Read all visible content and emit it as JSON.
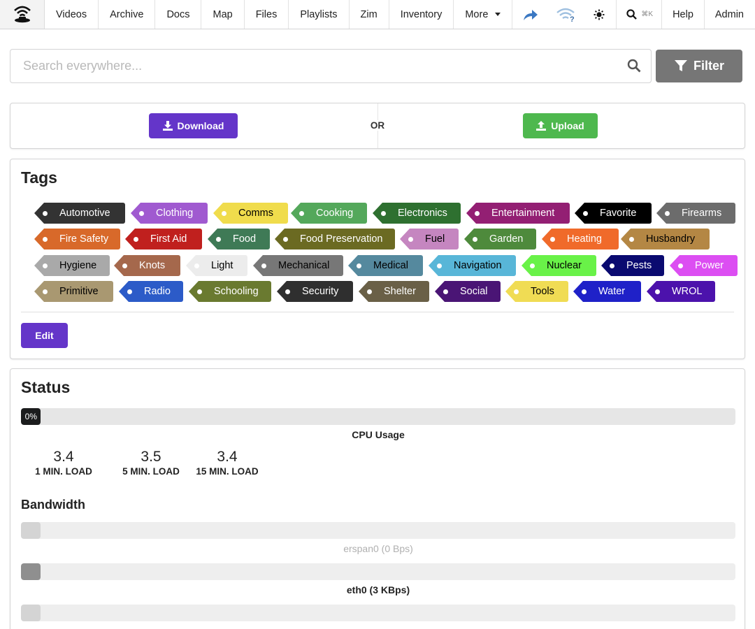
{
  "nav": {
    "items": [
      "Videos",
      "Archive",
      "Docs",
      "Map",
      "Files",
      "Playlists",
      "Zim",
      "Inventory"
    ],
    "more_label": "More",
    "search_shortcut": "⌘K",
    "help_label": "Help",
    "admin_label": "Admin"
  },
  "search": {
    "placeholder": "Search everywhere...",
    "value": "",
    "filter_label": "Filter"
  },
  "transfer": {
    "download_label": "Download",
    "or_label": "OR",
    "upload_label": "Upload"
  },
  "tags": {
    "title": "Tags",
    "edit_label": "Edit",
    "items": [
      {
        "name": "Automotive",
        "bg": "#333333",
        "fg": "#ffffff",
        "dot": "#ffffff"
      },
      {
        "name": "Clothing",
        "bg": "#a05ad0",
        "fg": "#ffffff",
        "dot": "#ffffff"
      },
      {
        "name": "Comms",
        "bg": "#f0dc4c",
        "fg": "#000000",
        "dot": "#ffffff"
      },
      {
        "name": "Cooking",
        "bg": "#54a85b",
        "fg": "#ffffff",
        "dot": "#ffffff"
      },
      {
        "name": "Electronics",
        "bg": "#2e7030",
        "fg": "#ffffff",
        "dot": "#ffffff"
      },
      {
        "name": "Entertainment",
        "bg": "#931f73",
        "fg": "#ffffff",
        "dot": "#ffffff"
      },
      {
        "name": "Favorite",
        "bg": "#000000",
        "fg": "#ffffff",
        "dot": "#ffffff"
      },
      {
        "name": "Firearms",
        "bg": "#6c6c6c",
        "fg": "#ffffff",
        "dot": "#ffffff"
      },
      {
        "name": "Fire Safety",
        "bg": "#d8692a",
        "fg": "#ffffff",
        "dot": "#ffffff"
      },
      {
        "name": "First Aid",
        "bg": "#c0201e",
        "fg": "#ffffff",
        "dot": "#ffffff"
      },
      {
        "name": "Food",
        "bg": "#3f7a56",
        "fg": "#ffffff",
        "dot": "#ffffff"
      },
      {
        "name": "Food Preservation",
        "bg": "#6b6a22",
        "fg": "#ffffff",
        "dot": "#ffffff"
      },
      {
        "name": "Fuel",
        "bg": "#c586c0",
        "fg": "#000000",
        "dot": "#ffffff"
      },
      {
        "name": "Garden",
        "bg": "#4e8a3c",
        "fg": "#ffffff",
        "dot": "#ffffff"
      },
      {
        "name": "Heating",
        "bg": "#f06a2a",
        "fg": "#ffffff",
        "dot": "#ffffff"
      },
      {
        "name": "Husbandry",
        "bg": "#b48744",
        "fg": "#000000",
        "dot": "#ffffff"
      },
      {
        "name": "Hygiene",
        "bg": "#a9a9a9",
        "fg": "#000000",
        "dot": "#ffffff"
      },
      {
        "name": "Knots",
        "bg": "#a5684c",
        "fg": "#ffffff",
        "dot": "#ffffff"
      },
      {
        "name": "Light",
        "bg": "#ececec",
        "fg": "#000000",
        "dot": "#ffffff"
      },
      {
        "name": "Mechanical",
        "bg": "#777777",
        "fg": "#000000",
        "dot": "#ffffff"
      },
      {
        "name": "Medical",
        "bg": "#55899e",
        "fg": "#000000",
        "dot": "#ffffff"
      },
      {
        "name": "Navigation",
        "bg": "#58b6d8",
        "fg": "#000000",
        "dot": "#ffffff"
      },
      {
        "name": "Nuclear",
        "bg": "#69f248",
        "fg": "#000000",
        "dot": "#ffffff"
      },
      {
        "name": "Pests",
        "bg": "#0a0a70",
        "fg": "#ffffff",
        "dot": "#ffffff"
      },
      {
        "name": "Power",
        "bg": "#dc4ef2",
        "fg": "#ffffff",
        "dot": "#ffffff"
      },
      {
        "name": "Primitive",
        "bg": "#a99871",
        "fg": "#000000",
        "dot": "#ffffff"
      },
      {
        "name": "Radio",
        "bg": "#2c5bc8",
        "fg": "#ffffff",
        "dot": "#ffffff"
      },
      {
        "name": "Schooling",
        "bg": "#6a7a30",
        "fg": "#ffffff",
        "dot": "#ffffff"
      },
      {
        "name": "Security",
        "bg": "#2f2f2f",
        "fg": "#ffffff",
        "dot": "#ffffff"
      },
      {
        "name": "Shelter",
        "bg": "#6a6047",
        "fg": "#ffffff",
        "dot": "#ffffff"
      },
      {
        "name": "Social",
        "bg": "#4a1575",
        "fg": "#ffffff",
        "dot": "#ffffff"
      },
      {
        "name": "Tools",
        "bg": "#f0dc54",
        "fg": "#000000",
        "dot": "#ffffff"
      },
      {
        "name": "Water",
        "bg": "#1f21c8",
        "fg": "#ffffff",
        "dot": "#ffffff"
      },
      {
        "name": "WROL",
        "bg": "#4c12ac",
        "fg": "#ffffff",
        "dot": "#ffffff"
      }
    ]
  },
  "status": {
    "title": "Status",
    "cpu": {
      "percent_label": "0%",
      "percent": 0,
      "label": "CPU Usage"
    },
    "loads": [
      {
        "value": "3.4",
        "label": "1 MIN. LOAD"
      },
      {
        "value": "3.5",
        "label": "5 MIN. LOAD"
      },
      {
        "value": "3.4",
        "label": "15 MIN. LOAD"
      }
    ],
    "bandwidth_title": "Bandwidth",
    "interfaces": [
      {
        "label": "erspan0 (0 Bps)",
        "color": "#d4d4d4",
        "text_color": "#b0b0b0"
      },
      {
        "label": "eth0 (3 KBps)",
        "color": "#8f8f8f",
        "text_color": "#222222"
      },
      {
        "label": "",
        "color": "#d4d4d4",
        "text_color": "#b0b0b0"
      }
    ]
  }
}
